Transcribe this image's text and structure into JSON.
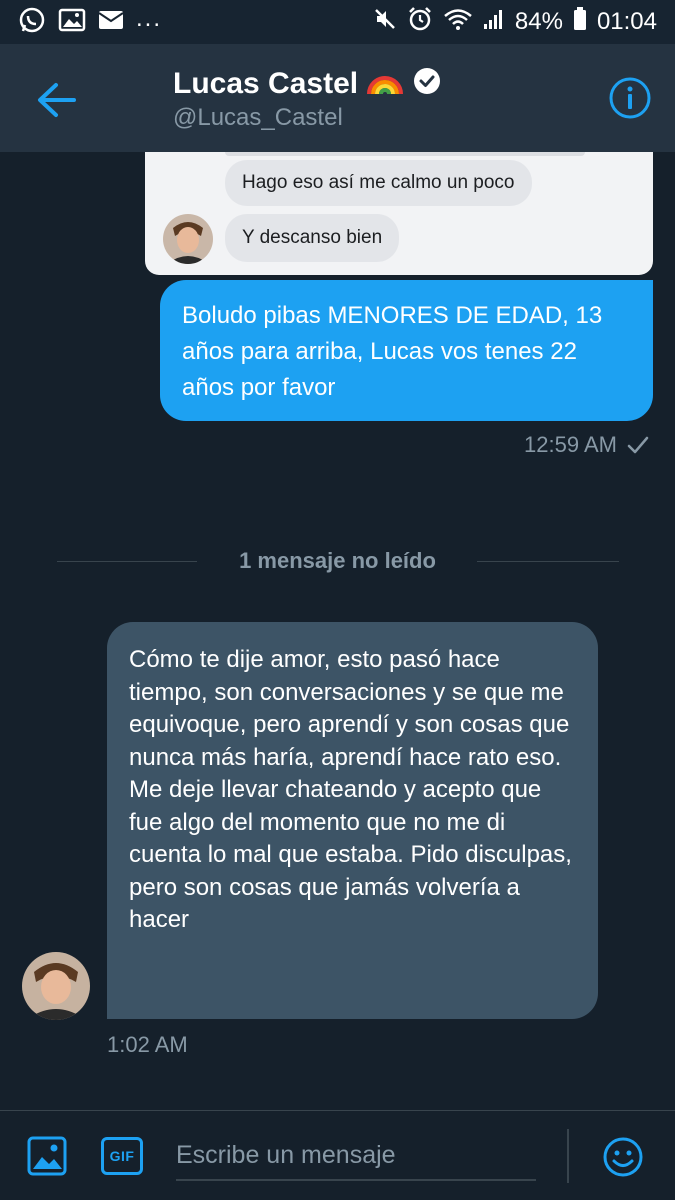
{
  "status_bar": {
    "icons": [
      "whatsapp-icon",
      "image-icon",
      "mail-icon"
    ],
    "more": "...",
    "battery": "84%",
    "time": "01:04"
  },
  "header": {
    "name": "Lucas Castel",
    "name_emoji": "🌈",
    "handle": "@Lucas_Castel",
    "back_icon": "back-arrow-icon",
    "info_icon": "info-icon",
    "verified_icon": "verified-badge-icon"
  },
  "embedded_screenshot": {
    "messages": [
      {
        "text": "Hago eso así me calmo un poco"
      },
      {
        "text": "Y descanso bien"
      }
    ]
  },
  "sent_message": {
    "text": "Boludo pibas MENORES DE EDAD, 13 años para arriba, Lucas vos tenes 22 años por favor",
    "time": "12:59 AM"
  },
  "divider": {
    "label": "1 mensaje no leído"
  },
  "received_message": {
    "text": "Cómo te dije amor, esto pasó hace tiempo, son conversaciones y se que me equivoque, pero aprendí y son cosas que nunca más haría, aprendí hace rato eso. Me deje llevar chateando y acepto que fue algo del momento que no me di cuenta lo mal que estaba. Pido disculpas, pero son cosas que jamás volvería a hacer",
    "time": "1:02 AM"
  },
  "composer": {
    "placeholder": "Escribe un mensaje",
    "gif_label": "GIF"
  },
  "colors": {
    "accent": "#1da1f2",
    "background": "#15202b",
    "header": "#253341",
    "received_bubble": "#3d5466",
    "muted_text": "#8899a6"
  }
}
